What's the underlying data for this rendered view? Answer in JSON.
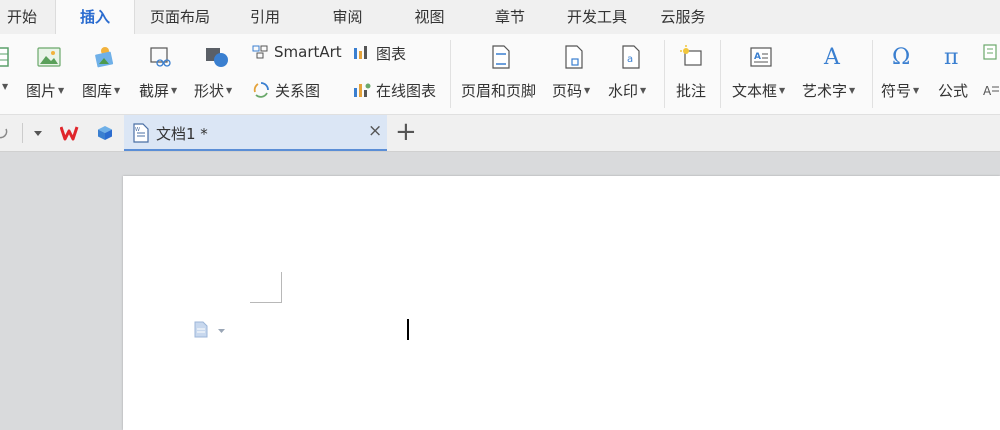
{
  "menu": {
    "tabs": [
      {
        "label": "开始"
      },
      {
        "label": "插入"
      },
      {
        "label": "页面布局"
      },
      {
        "label": "引用"
      },
      {
        "label": "审阅"
      },
      {
        "label": "视图"
      },
      {
        "label": "章节"
      },
      {
        "label": "开发工具"
      },
      {
        "label": "云服务"
      }
    ],
    "active": "插入"
  },
  "ribbon": {
    "picture": "图片",
    "gallery": "图库",
    "screenshot": "截屏",
    "shapes": "形状",
    "smartart": "SmartArt",
    "chart": "图表",
    "relation": "关系图",
    "online_chart": "在线图表",
    "header_footer": "页眉和页脚",
    "page_number": "页码",
    "watermark": "水印",
    "comment": "批注",
    "textbox": "文本框",
    "wordart": "艺术字",
    "symbol": "符号",
    "formula": "公式"
  },
  "tabbar": {
    "document_tab": "文档1 *",
    "new_tab": "+",
    "close": "×"
  },
  "colors": {
    "accent": "#2b6ccf",
    "wps_red": "#e0262c",
    "tab_active_bg": "#dbe6f5"
  }
}
